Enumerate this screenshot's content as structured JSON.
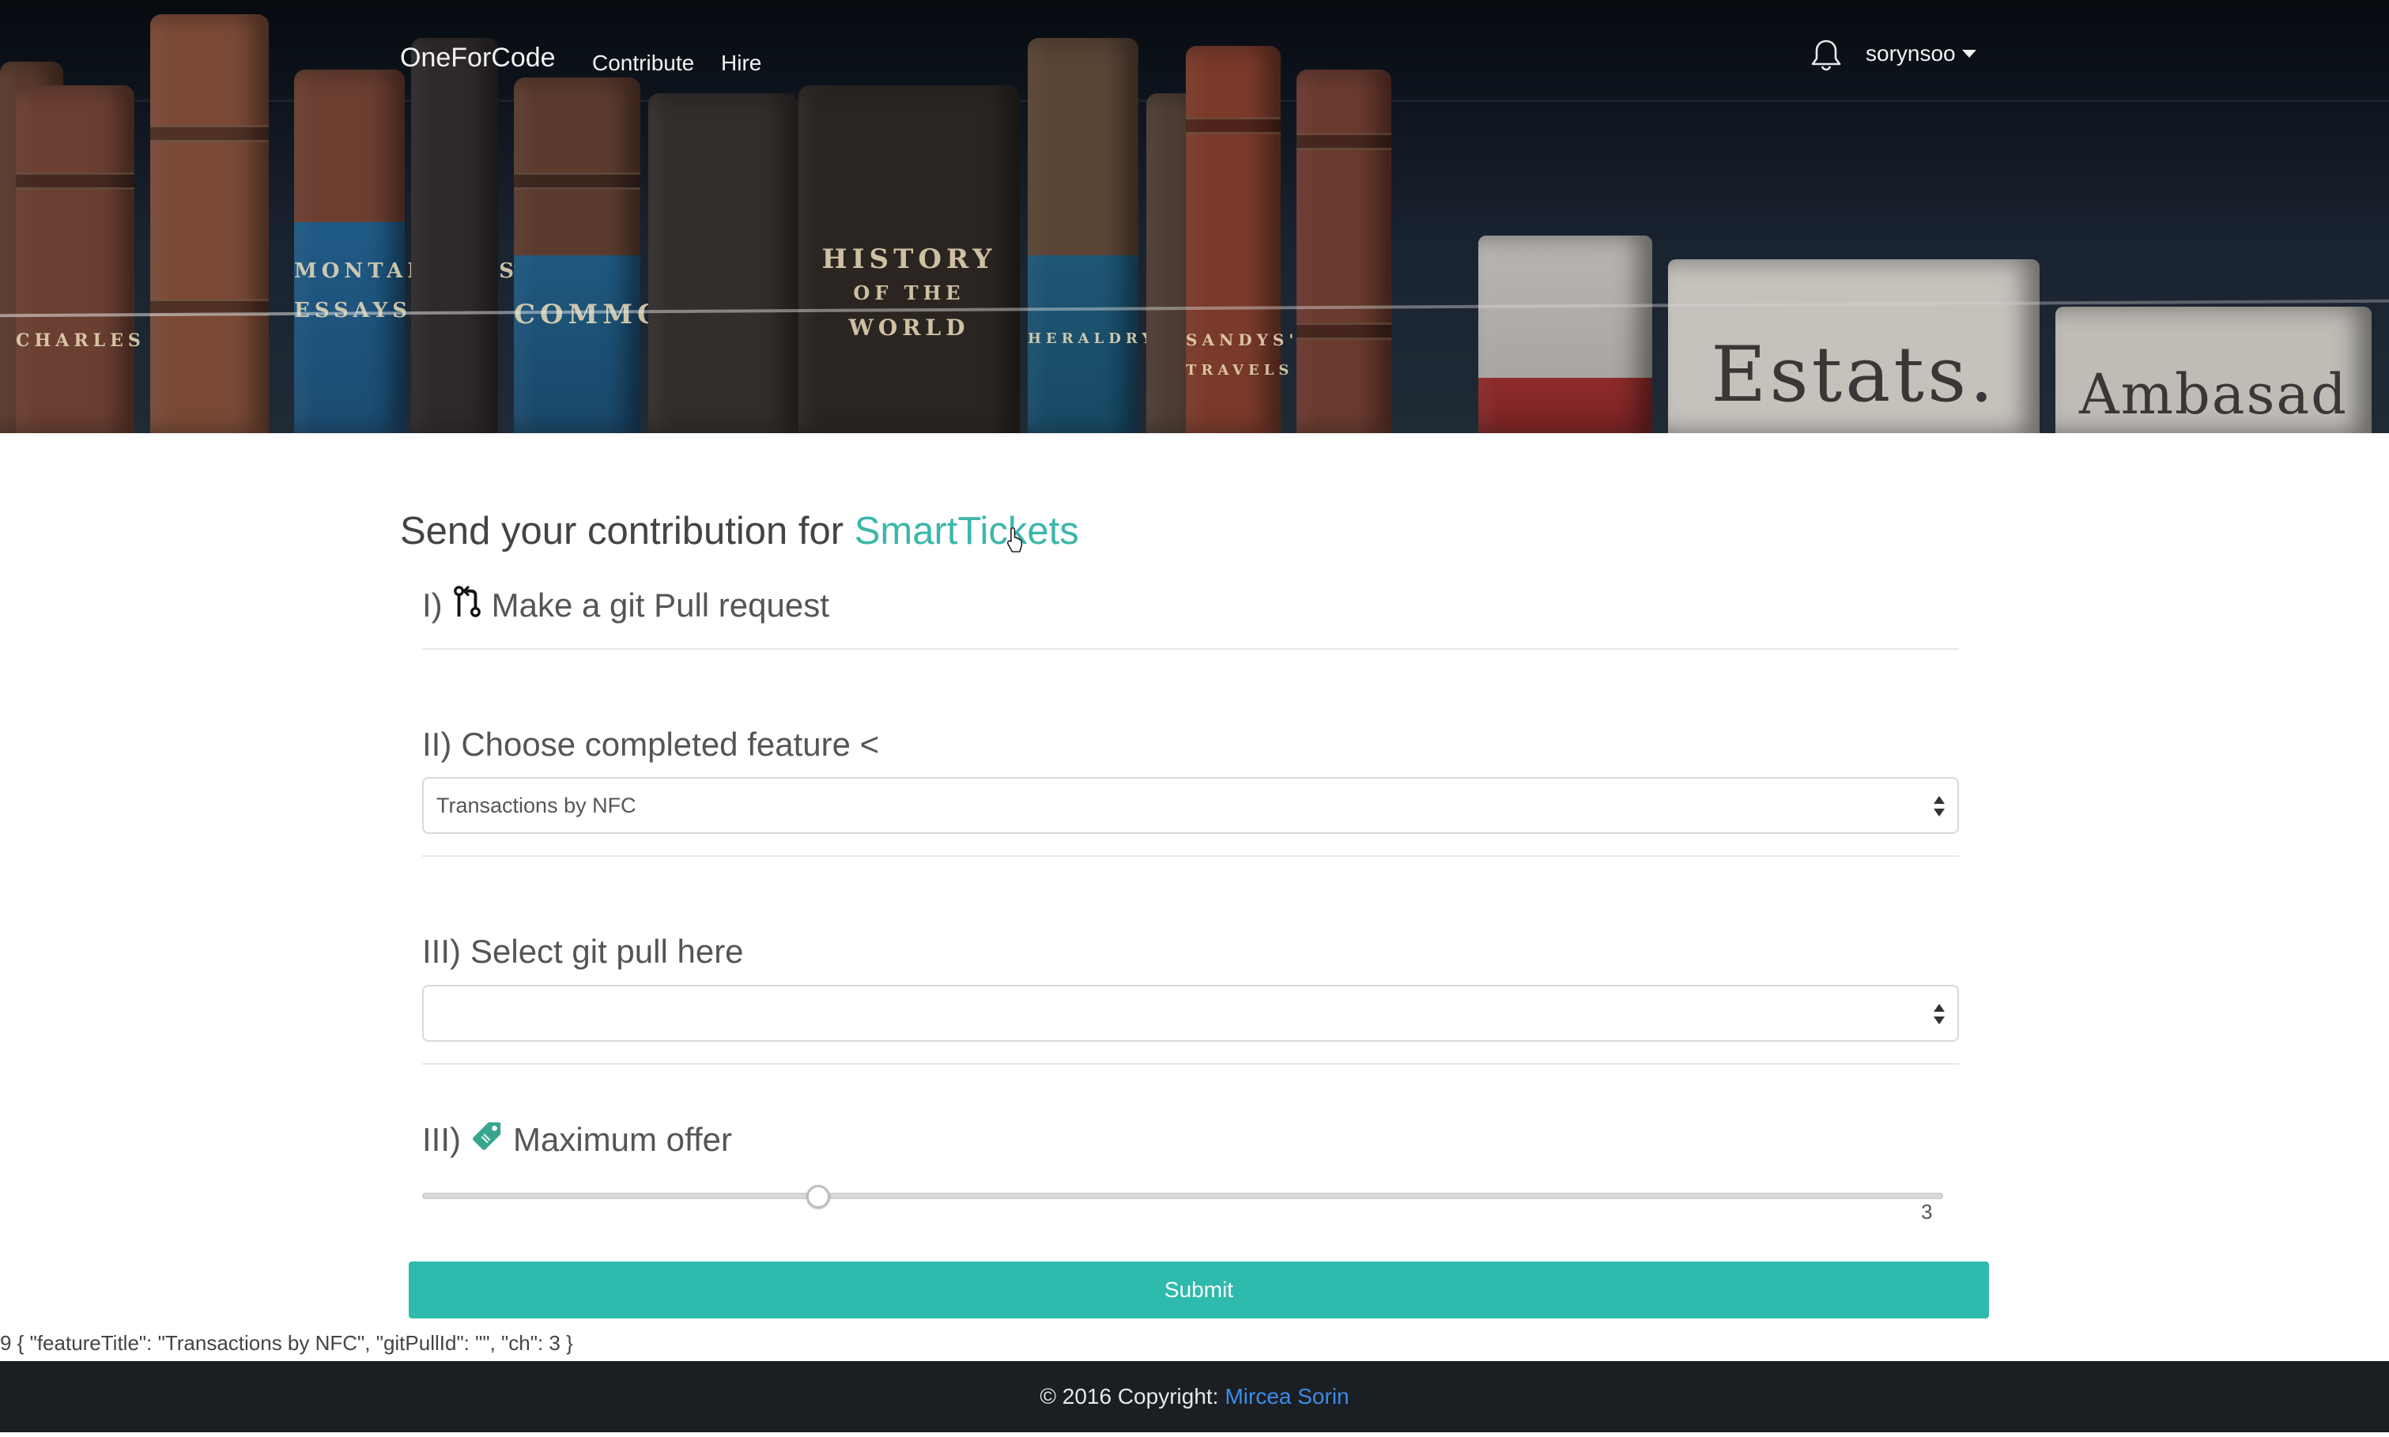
{
  "navbar": {
    "brand": "OneForCode",
    "links": [
      "Contribute",
      "Hire"
    ],
    "username": "sorynsoo"
  },
  "hero": {
    "spines": [
      "MONTAIGNE'S",
      "ESSAYS",
      "COMMO",
      "HISTORY",
      "OF THE",
      "WORLD",
      "Estats.",
      "Ambasad",
      "SANDYS'S",
      "TRAVELS",
      "HERALDRY",
      "CHARLES"
    ]
  },
  "form": {
    "title_prefix": "Send your contribution for",
    "project_name": "SmartTickets",
    "step1": {
      "number": "I)",
      "label": "Make a git Pull request"
    },
    "step2": {
      "number": "II)",
      "label": "Choose completed feature <",
      "selected": "Transactions by NFC"
    },
    "step3": {
      "number": "III)",
      "label": "Select git pull here",
      "selected": ""
    },
    "step4": {
      "number": "III)",
      "label": "Maximum offer"
    },
    "slider": {
      "value": 3,
      "fraction": 0.26
    },
    "submit_label": "Submit"
  },
  "debug_output": "9 { \"featureTitle\": \"Transactions by NFC\", \"gitPullId\": \"\", \"ch\": 3 }",
  "footer": {
    "copyright": "© 2016 Copyright:",
    "author": "Mircea Sorin"
  },
  "colors": {
    "accent": "#2ebaac",
    "project_link": "#3bb7a9",
    "footer_bg": "#1b1e23",
    "footer_link": "#3b8de8"
  }
}
